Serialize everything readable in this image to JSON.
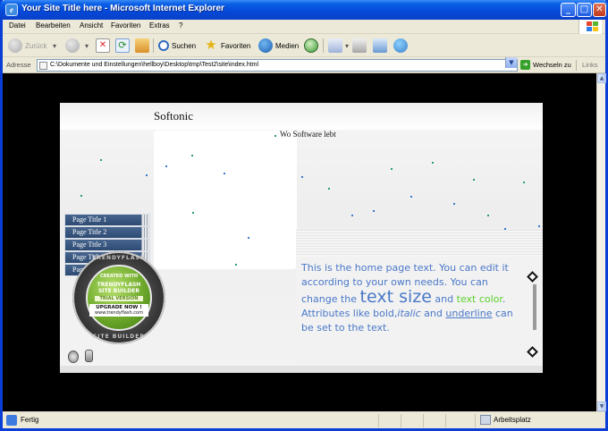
{
  "window": {
    "title": "Your Site Title here - Microsoft Internet Explorer",
    "minimize": "_",
    "maximize": "□",
    "close": "✕"
  },
  "menu": [
    "Datei",
    "Bearbeiten",
    "Ansicht",
    "Favoriten",
    "Extras",
    "?"
  ],
  "toolbar": {
    "back": "Zurück",
    "search": "Suchen",
    "favorites": "Favoriten",
    "media": "Medien"
  },
  "address": {
    "label": "Adresse",
    "url": "C:\\Dokumente und Einstellungen\\hellboy\\Desktop\\tmp\\Test2\\site\\index.html",
    "go_label": "Wechseln zu",
    "links_label": "Links"
  },
  "site": {
    "name": "Softonic",
    "slogan": "Wo Software lebt",
    "nav": [
      "Page Title 1",
      "Page Title 2",
      "Page Title 3",
      "Page Title 4",
      "Page Title 5"
    ],
    "badge": {
      "ring_top": "TRENDYFLASH",
      "ring_bottom": "SITE BUILDER",
      "created_with": "CREATED WITH",
      "line1": "TRENDYFLASH",
      "line2": "SITE BUILDER",
      "trial": "TRIAL VERSION",
      "upgrade": "UPGRADE NOW !",
      "url": "www.trendyflash.com"
    },
    "home_text": {
      "p1": "This is the home page text. You can edit it according to your own needs. You",
      "p2a": " can change the ",
      "p2big": "text size",
      "p2b": " and",
      "green": "text color",
      "p3a": ". Attributes like bold,",
      "italic": "italic",
      "p3b": " and",
      "underline": "underline",
      "p4": "  can be set to the text."
    }
  },
  "status": {
    "text": "Fertig",
    "zone": "Arbeitsplatz"
  },
  "colors": {
    "title_bar": "#0548d8",
    "page_background": "#000000",
    "nav_item": "#3a5a84",
    "home_text": "#4a78c8",
    "green_text": "#5cd12e"
  }
}
